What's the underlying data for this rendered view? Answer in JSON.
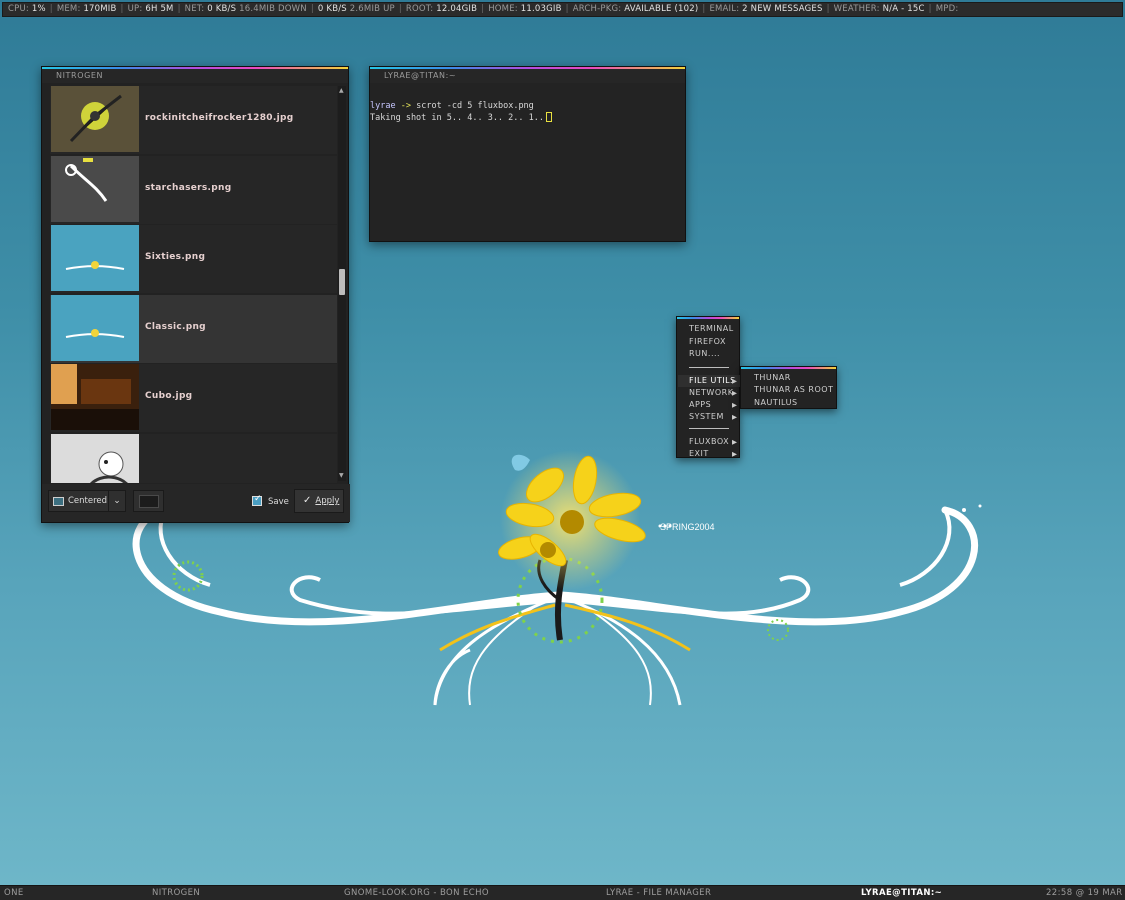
{
  "statusbar": {
    "items": [
      {
        "key": "CPU:",
        "value": "1%"
      },
      {
        "key": "MEM:",
        "value": "170MIB"
      },
      {
        "key": "UP:",
        "value": "6H 5M"
      },
      {
        "key": "NET:",
        "value": "0 KB/S",
        "extra": "16.4MIB DOWN"
      },
      {
        "key": "",
        "value": "0 KB/S",
        "extra": "2.6MIB UP"
      },
      {
        "key": "ROOT:",
        "value": "12.04GIB"
      },
      {
        "key": "HOME:",
        "value": "11.03GIB"
      },
      {
        "key": "ARCH-PKG:",
        "value": "AVAILABLE (102)"
      },
      {
        "key": "EMAIL:",
        "value": "2 NEW MESSAGES"
      },
      {
        "key": "WEATHER:",
        "value": "N/A - 15C"
      },
      {
        "key": "MPD:",
        "value": ""
      }
    ]
  },
  "wallpaper": {
    "spring_label": "SPRING2004",
    "colors": {
      "flower": "#f6d21a",
      "swirl": "#ffffff",
      "accent": "#7fd24a"
    }
  },
  "nitrogen": {
    "title": "NITROGEN",
    "files": [
      {
        "name": "rockinitcheifrocker1280.jpg",
        "thumb": "rock"
      },
      {
        "name": "starchasers.png",
        "thumb": "star"
      },
      {
        "name": "Sixties.png",
        "thumb": "sixties"
      },
      {
        "name": "Classic.png",
        "thumb": "classic",
        "selected": true
      },
      {
        "name": "Cubo.jpg",
        "thumb": "cubo"
      },
      {
        "name": "",
        "thumb": "figure"
      }
    ],
    "mode_label": "Centered",
    "save_label": "Save",
    "apply_label": "Apply"
  },
  "terminal": {
    "title": "LYRAE@TITAN:~",
    "prompt_user": "lyrae",
    "prompt_arrow": "->",
    "command": "scrot -cd 5 fluxbox.png",
    "output": "Taking shot in 5.. 4.. 3.. 2.. 1.."
  },
  "rootmenu": {
    "items": [
      "TERMINAL",
      "FIREFOX",
      "RUN...."
    ],
    "submenus": [
      "FILE UTILS",
      "NETWORK",
      "APPS",
      "SYSTEM"
    ],
    "tail": [
      "FLUXBOX",
      "EXIT"
    ],
    "file_utils": [
      "THUNAR",
      "THUNAR AS ROOT",
      "NAUTILUS"
    ]
  },
  "taskbar": {
    "workspace": "ONE",
    "tasks": [
      "NITROGEN",
      "GNOME-LOOK.ORG - BON ECHO",
      "LYRAE - FILE MANAGER",
      "LYRAE@TITAN:~"
    ],
    "clock": "22:58 @ 19 MAR"
  }
}
